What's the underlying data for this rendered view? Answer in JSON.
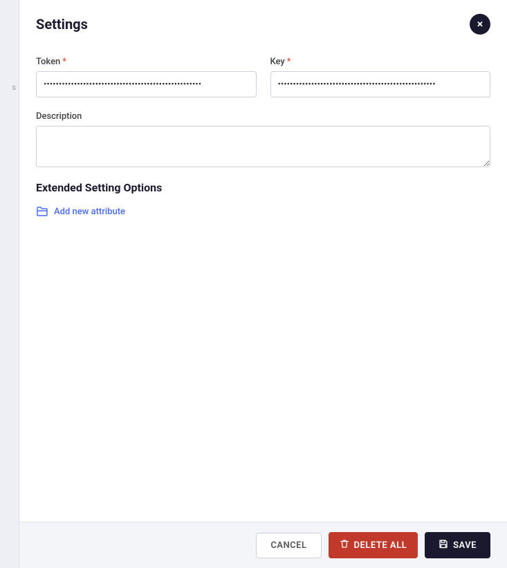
{
  "modal": {
    "title": "Settings",
    "close_label": "×"
  },
  "form": {
    "token_label": "Token",
    "token_required": "*",
    "token_value": "••••••••••••••••••••••••••••••••••••••••••••••••••••",
    "key_label": "Key",
    "key_required": "*",
    "key_value": "••••••••••••••••••••••••••••••••••••••••••••••••••••",
    "description_label": "Description",
    "description_placeholder": ""
  },
  "extended": {
    "section_title": "Extended Setting Options",
    "add_attribute_label": "Add new attribute"
  },
  "footer": {
    "cancel_label": "CANCEL",
    "delete_label": "DELETE ALL",
    "save_label": "SAVE"
  },
  "icons": {
    "close": "✕",
    "folder": "🗁",
    "trash": "🗑",
    "save": "💾"
  }
}
